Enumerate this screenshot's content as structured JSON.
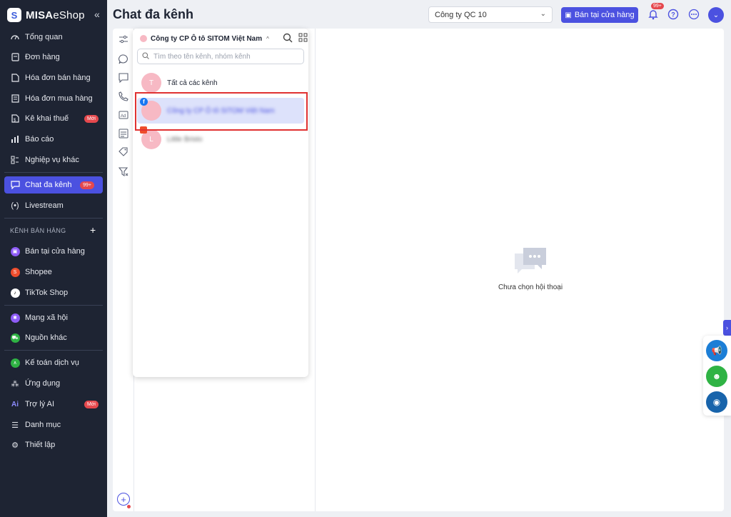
{
  "brand": {
    "name_bold": "MISA",
    "name_light": "eShop"
  },
  "sidebar": {
    "items": [
      {
        "label": "Tổng quan",
        "icon": "gauge-icon"
      },
      {
        "label": "Đơn hàng",
        "icon": "order-icon"
      },
      {
        "label": "Hóa đơn bán hàng",
        "icon": "invoice-icon"
      },
      {
        "label": "Hóa đơn mua hàng",
        "icon": "purchase-invoice-icon"
      },
      {
        "label": "Kê khai thuế",
        "icon": "tax-icon",
        "badge": "Mới"
      },
      {
        "label": "Báo cáo",
        "icon": "report-icon"
      },
      {
        "label": "Nghiệp vụ khác",
        "icon": "tasks-icon"
      },
      {
        "label": "Chat đa kênh",
        "icon": "chat-icon",
        "badge": "99+",
        "active": true
      },
      {
        "label": "Livestream",
        "icon": "livestream-icon"
      }
    ],
    "section_title": "KÊNH BÁN HÀNG",
    "channels": [
      {
        "label": "Bán tại cửa hàng",
        "color": "#8e5cf7"
      },
      {
        "label": "Shopee",
        "color": "#ee4d2d"
      },
      {
        "label": "TikTok Shop",
        "color": "#000000"
      },
      {
        "label": "Mạng xã hội",
        "color": "#8e5cf7"
      },
      {
        "label": "Nguồn khác",
        "color": "#2fb344"
      }
    ],
    "bottom": [
      {
        "label": "Kế toán dịch vụ",
        "icon": "accounting-icon"
      },
      {
        "label": "Ứng dụng",
        "icon": "apps-icon"
      },
      {
        "label": "Trợ lý AI",
        "icon": "ai-icon",
        "badge": "Mới"
      },
      {
        "label": "Danh mục",
        "icon": "list-icon"
      },
      {
        "label": "Thiết lập",
        "icon": "settings-icon"
      }
    ]
  },
  "header": {
    "title": "Chat đa kênh",
    "company": "Công ty QC 10",
    "store_button": "Bán tại cửa hàng",
    "bell_badge": "99+"
  },
  "panel": {
    "title": "Công ty CP Ô tô SITOM Việt Nam",
    "search_placeholder": "Tìm theo tên kênh, nhóm kênh",
    "rows": [
      {
        "avatar": "T",
        "label": "Tất cả các kênh"
      },
      {
        "avatar": "",
        "label": "Công ty CP Ô tô SITOM Việt Nam",
        "platform": "facebook",
        "selected": true
      },
      {
        "avatar": "L",
        "label": "Little Bristo",
        "platform": "shopee"
      }
    ]
  },
  "empty_state": {
    "label": "Chưa chọn hội thoại"
  },
  "colors": {
    "accent": "#4b51e0",
    "sidebar_bg": "#1e2433",
    "badge": "#e5484d",
    "highlight": "#e03131"
  }
}
